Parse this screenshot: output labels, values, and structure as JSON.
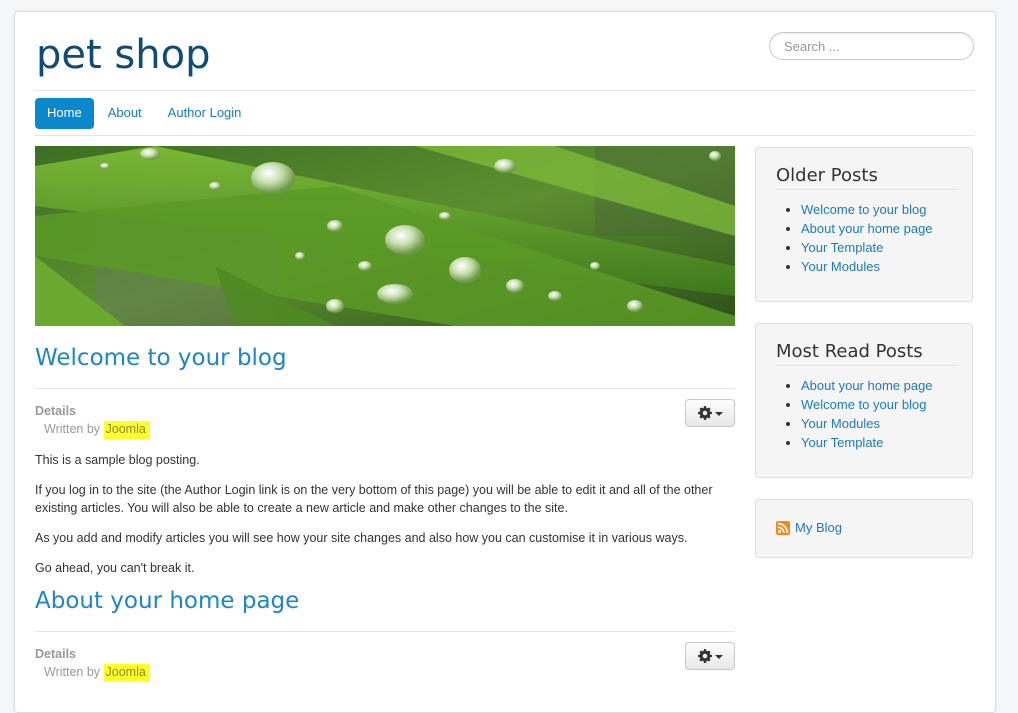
{
  "site": {
    "title": "pet shop"
  },
  "search": {
    "placeholder": "Search ..."
  },
  "nav": {
    "items": [
      {
        "label": "Home",
        "active": true
      },
      {
        "label": "About"
      },
      {
        "label": "Author Login"
      }
    ]
  },
  "articles": [
    {
      "title": "Welcome to your blog",
      "details_label": "Details",
      "written_by_label": "Written by",
      "author": "Joomla",
      "paragraphs": [
        "This is a sample blog posting.",
        "If you log in to the site (the Author Login link is on the very bottom of this page) you will be able to edit it and all of the other existing articles. You will also be able to create a new article and make other changes to the site.",
        "As you add and modify articles you will see how your site changes and also how you can customise it in various ways.",
        "Go ahead, you can't break it."
      ]
    },
    {
      "title": "About your home page",
      "details_label": "Details",
      "written_by_label": "Written by",
      "author": "Joomla",
      "paragraphs": []
    }
  ],
  "sidebar": {
    "older_posts": {
      "title": "Older Posts",
      "items": [
        "Welcome to your blog",
        "About your home page",
        "Your Template",
        "Your Modules"
      ]
    },
    "most_read": {
      "title": "Most Read Posts",
      "items": [
        "About your home page",
        "Welcome to your blog",
        "Your Modules",
        "Your Template"
      ]
    },
    "feed": {
      "label": "My Blog",
      "icon": "rss-icon"
    }
  },
  "icons": {
    "gear": "gear-icon",
    "caret": "caret-down-icon"
  },
  "colors": {
    "link": "#1c7bbd",
    "active_nav": "#0b88cc",
    "title": "#0f4c75",
    "highlight": "#ffff2a"
  }
}
